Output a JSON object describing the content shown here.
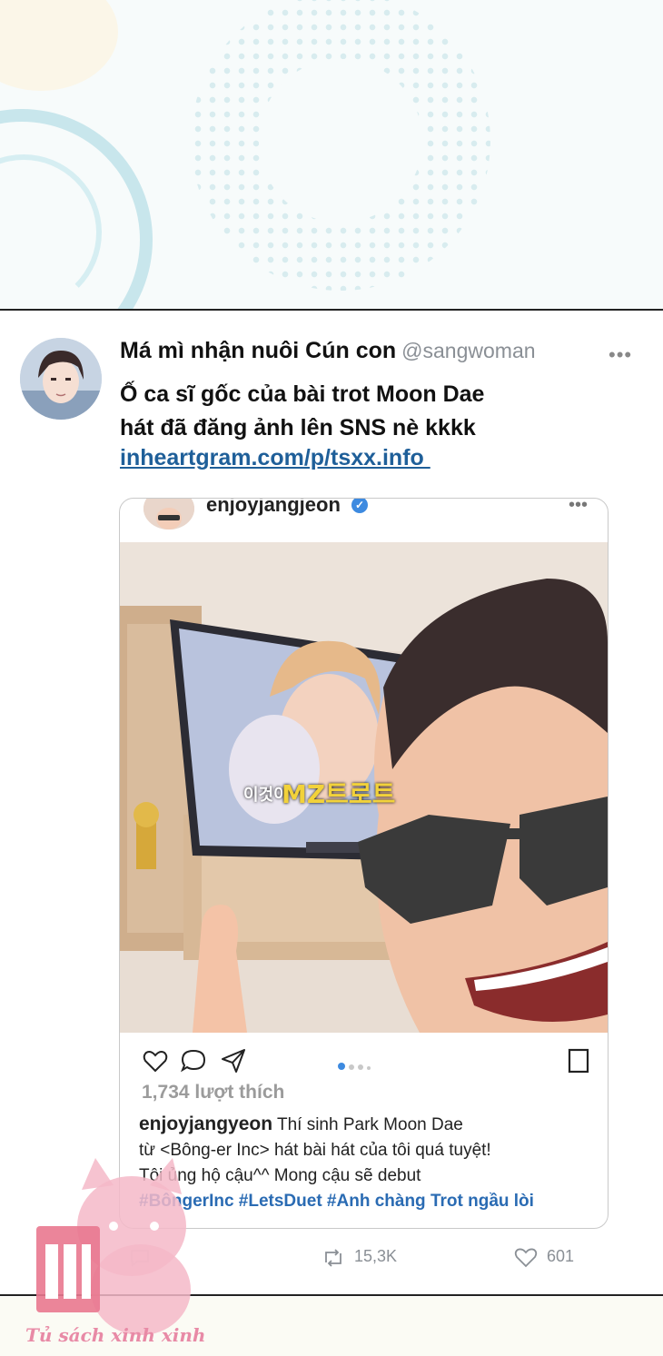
{
  "tweet": {
    "author_name": "Má mì nhận nuôi Cún con",
    "handle": "@sangwoman",
    "more": "•••",
    "text_line1": "Ố ca sĩ gốc của bài trot Moon Dae",
    "text_line2": "hát đã đăng ảnh lên SNS nè kkkk",
    "link": "inheartgram.com/p/tsxx.info "
  },
  "post": {
    "username": "enjoyjangjeon",
    "more": "•••",
    "photo_overlay_prefix": "이것이",
    "photo_overlay_title": "MZ트로트",
    "likes": "1,734 lượt thích",
    "caption_user": "enjoyjangyeon",
    "caption_line1": "Thí sinh Park Moon Dae",
    "caption_line2": "từ <Bông-er Inc> hát bài hát của tôi quá tuyệt!",
    "caption_line3": "Tôi ủng hộ cậu^^ Mong cậu sẽ debut",
    "hashtags": "#BôngerInc #LetsDuet #Anh chàng Trot ngầu lòi"
  },
  "stats": {
    "retweets": "15,3K",
    "likes": "601"
  },
  "watermark": {
    "text": "Tủ sách xinh xinh"
  },
  "colors": {
    "link": "#1f5f99",
    "hashtag": "#2a6bb3",
    "verified": "#3d8ae0",
    "watermark": "#e88aa6"
  }
}
